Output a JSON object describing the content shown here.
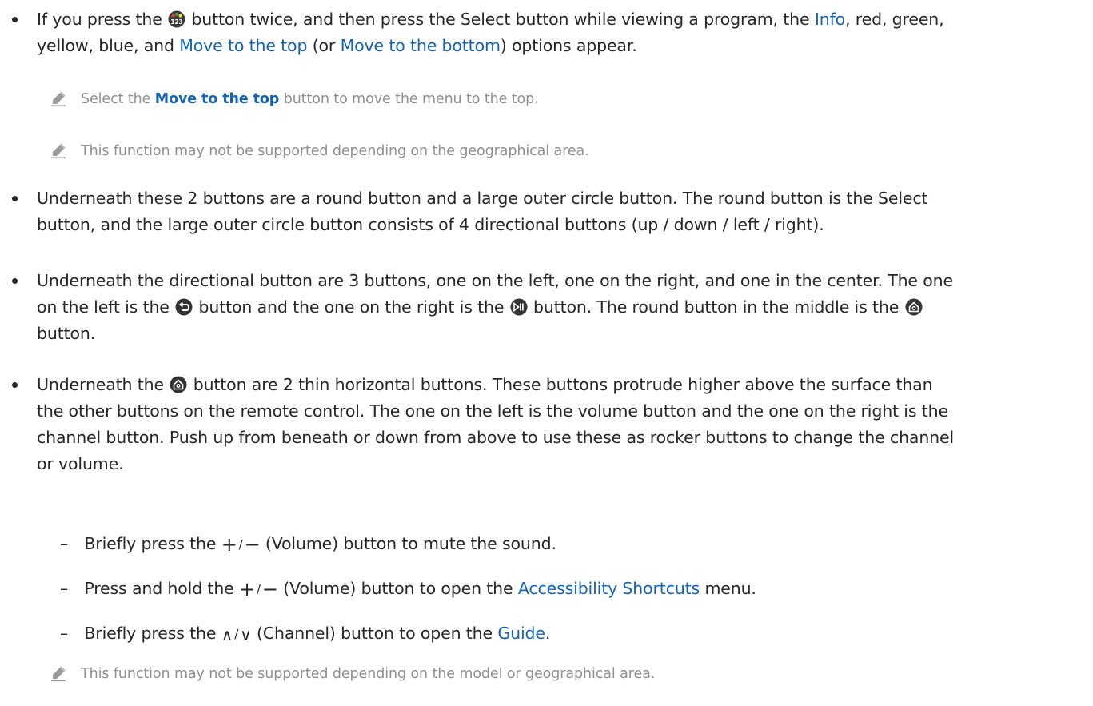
{
  "bullet1": {
    "t1": "If you press the",
    "t2": "button twice, and then press the Select button while viewing a program, the",
    "info": "Info",
    "t3": ", red, green,",
    "t4": "yellow, blue, and",
    "move_top": "Move to the top",
    "t5": "(or",
    "move_bottom": "Move to the bottom",
    "t6": ") options appear."
  },
  "note1": {
    "t1": "Select the",
    "link": "Move to the top",
    "t2": "button to move the menu to the top."
  },
  "note2": {
    "text": "This function may not be supported depending on the geographical area."
  },
  "bullet2": {
    "line1": "Underneath these 2 buttons are a round button and a large outer circle button. The round button is the Select",
    "line2": "button, and the large outer circle button consists of 4 directional buttons (up / down / left / right)."
  },
  "bullet3": {
    "line1": "Underneath the directional button are 3 buttons, one on the left, one on the right, and one in the center. The one",
    "t1": "on the left is the",
    "t2": "button and the one on the right is the",
    "t3": "button. The round button in the middle is the",
    "line3": "button."
  },
  "bullet4": {
    "t1": "Underneath the",
    "t2": "button are 2 thin horizontal buttons. These buttons protrude higher above the surface than",
    "line2": "the other buttons on the remote control. The one on the left is the volume button and the one on the right is the",
    "line3": "channel button. Push up from beneath or down from above to use these as rocker buttons to change the channel",
    "line4": "or volume."
  },
  "sub1": {
    "dash": "–",
    "t1": "Briefly press the",
    "plus": "+",
    "slash": "/",
    "minus": "−",
    "t2": "(Volume) button to mute the sound."
  },
  "sub2": {
    "dash": "–",
    "t1": "Press and hold the",
    "plus": "+",
    "slash": "/",
    "minus": "−",
    "t2": "(Volume) button to open the",
    "link": "Accessibility Shortcuts",
    "t3": "menu."
  },
  "sub3": {
    "dash": "–",
    "t1": "Briefly press the",
    "up": "∧",
    "slash": "/",
    "down": "∨",
    "t2": "(Channel) button to open the",
    "link": "Guide",
    "t3": "."
  },
  "note3": {
    "text": "This function may not be supported depending on the model or geographical area."
  },
  "icons": {
    "color_button": "color-123-icon",
    "return": "return-icon",
    "play_pause": "play-pause-icon",
    "home": "home-icon",
    "note": "pencil-note-icon"
  }
}
